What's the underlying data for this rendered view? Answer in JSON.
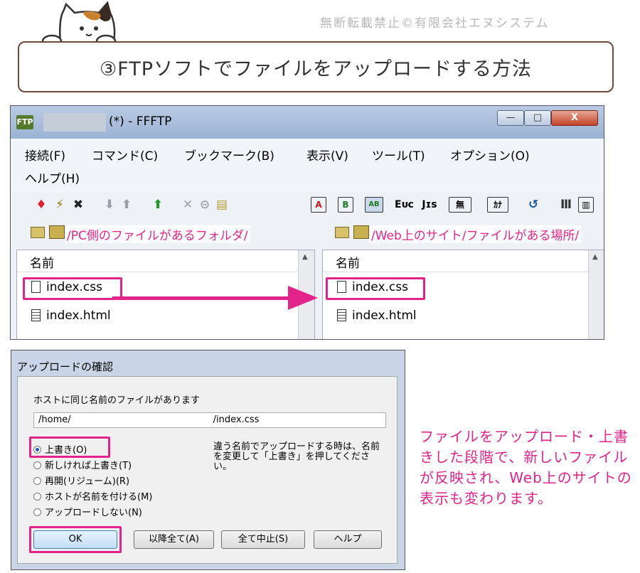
{
  "header": {
    "copyright": "無断転載禁止©有限会社エヌシステム",
    "title": "③FTPソフトでファイルをアップロードする方法"
  },
  "ftp_window": {
    "title": "(*) - FFFTP",
    "app_icon_label": "FTP",
    "controls": {
      "minimize": "—",
      "maximize": "□",
      "close": "X"
    },
    "menu": [
      "接続(F)",
      "コマンド(C)",
      "ブックマーク(B)",
      "表示(V)",
      "ツール(T)",
      "オプション(O)",
      "ヘルプ(H)"
    ],
    "toolbar": {
      "mode_a": "A",
      "mode_b": "B",
      "mode_auto": "AB",
      "kanji_euc": "Eᴜᴄ",
      "kanji_jis": "Jɪs",
      "kanji_none": "無",
      "kana": "ｶﾅ",
      "colors": {
        "connect": "#e0202e",
        "upload": "#1f9a2c",
        "disabled": "#9aa0a8"
      }
    },
    "local_pane": {
      "path_label": "/PC側のファイルがあるフォルダ/",
      "column_header": "名前",
      "files": [
        "index.css",
        "index.html"
      ]
    },
    "remote_pane": {
      "path_label": "/Web上のサイト/ファイルがある場所/",
      "column_header": "名前",
      "files": [
        "index.css",
        "index.html"
      ]
    }
  },
  "dialog": {
    "title": "アップロードの確認",
    "message": "ホストに同じ名前のファイルがあります",
    "path_prefix": "/home/",
    "path_suffix": "/index.css",
    "options": [
      "上書き(O)",
      "新しければ上書き(T)",
      "再開(リジューム)(R)",
      "ホストが名前を付ける(M)",
      "アップロードしない(N)"
    ],
    "selected_option": "上書き(O)",
    "note": "違う名前でアップロードする時は、名前を変更して「上書き」を押してください。",
    "buttons": {
      "ok": "OK",
      "all": "以降全て(A)",
      "stop": "全て中止(S)",
      "help": "ヘルプ"
    }
  },
  "annotation": {
    "text": "ファイルをアップロード・上書きした段階で、新しいファイルが反映され、Web上のサイトの表示も変わります。",
    "color": "#e2238a"
  }
}
